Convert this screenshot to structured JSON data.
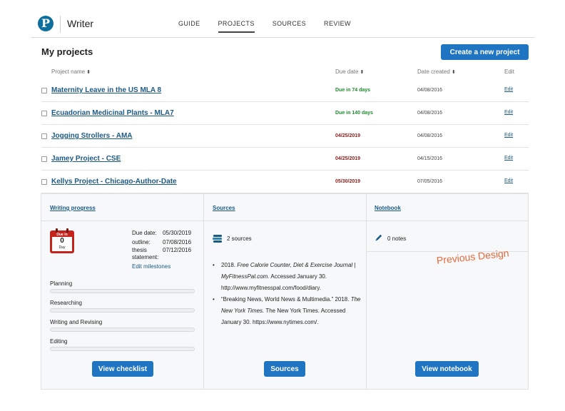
{
  "app": {
    "logo_letter": "P",
    "name": "Writer"
  },
  "nav": {
    "items": [
      {
        "label": "GUIDE"
      },
      {
        "label": "PROJECTS",
        "active": true
      },
      {
        "label": "SOURCES"
      },
      {
        "label": "REVIEW"
      }
    ]
  },
  "page": {
    "title": "My projects",
    "create_label": "Create a new project"
  },
  "table": {
    "headers": {
      "name": "Project name",
      "due": "Due date",
      "created": "Date created",
      "edit": "Edit",
      "sort_glyph": "⬍"
    },
    "rows": [
      {
        "name": "Maternity Leave in the US MLA 8",
        "due": "Due in 74 days",
        "due_status": "upcoming",
        "created": "04/08/2016",
        "edit": "Edit"
      },
      {
        "name": "Ecuadorian Medicinal Plants - MLA7",
        "due": "Due in 140 days",
        "due_status": "upcoming",
        "created": "04/08/2016",
        "edit": "Edit"
      },
      {
        "name": "Jogging Strollers - AMA",
        "due": "04/25/2019",
        "due_status": "overdue",
        "created": "04/08/2016",
        "edit": "Edit"
      },
      {
        "name": "Jamey Project - CSE",
        "due": "04/25/2019",
        "due_status": "overdue",
        "created": "04/15/2016",
        "edit": "Edit"
      },
      {
        "name": "Kellys Project - Chicago-Author-Date",
        "due": "05/30/2019",
        "due_status": "overdue",
        "created": "07/05/2016",
        "edit": "Edit"
      }
    ]
  },
  "colors": {
    "brand": "#0e6f9c",
    "button": "#1f75c2",
    "link": "#1c5a86",
    "upcoming": "#1e8a2e",
    "overdue": "#8c1c1c",
    "calendar": "#c4241c",
    "annotation": "#e8683c"
  },
  "progress": {
    "title": "Writing progress",
    "calendar": {
      "top": "Due in",
      "number": "0",
      "unit": "Day"
    },
    "meta": [
      {
        "label": "Due date:",
        "value": "05/30/2019"
      },
      {
        "label": "outline:",
        "value": "07/08/2016"
      },
      {
        "label": "thesis statement:",
        "value": "07/12/2016"
      }
    ],
    "edit_milestones": "Edit milestones",
    "stages": [
      {
        "label": "Planning",
        "fraction": 0
      },
      {
        "label": "Researching",
        "fraction": 0
      },
      {
        "label": "Writing and Revising",
        "fraction": 0
      },
      {
        "label": "Editing",
        "fraction": 0
      }
    ],
    "button": "View checklist"
  },
  "sources": {
    "title": "Sources",
    "count": "2 sources",
    "citations": [
      {
        "prefix": "2018. ",
        "italic": "Free Calorie Counter, Diet & Exercise Journal | MyFitnessPal.com.",
        "suffix": " Accessed January 30. http://www.myfitnesspal.com/food/diary."
      },
      {
        "prefix": "“Breaking News, World News & Multimedia.” 2018. ",
        "italic": "The New York Times.",
        "suffix": " The New York Times. Accessed January 30. https://www.nytimes.com/."
      }
    ],
    "button": "Sources"
  },
  "notebook": {
    "title": "Notebook",
    "count": "0 notes",
    "button": "View notebook"
  },
  "annotation": "Previous Design"
}
